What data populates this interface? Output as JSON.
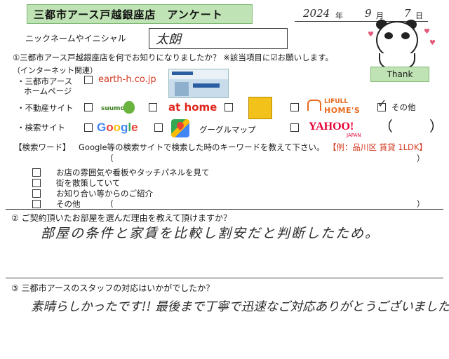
{
  "header": {
    "title": "三都市アース戸越銀座店　アンケート",
    "date": {
      "year_value": "2024",
      "year_label": "年",
      "month_value": "9",
      "month_label": "月",
      "day_value": "7",
      "day_label": "日"
    }
  },
  "nickname": {
    "label": "ニックネームやイニシャル",
    "value": "太朗"
  },
  "q1": {
    "question": "①三都市アース戸越銀座店を何でお知りになりましたか？ ※該当項目に☑お願いします。",
    "internet_heading": "（インターネット関連）",
    "homepage_label_1": "・三都市アース",
    "homepage_label_2": "ホームページ",
    "homepage_url": "earth-h.co.jp",
    "realestate_label": "・不動産サイト",
    "suumo": "suumo",
    "athome": "at home",
    "lifull": "LIFULL",
    "homes": "HOME'S",
    "other_label": "その他",
    "search_label": "・検索サイト",
    "google_letters": [
      "G",
      "o",
      "o",
      "g",
      "l",
      "e"
    ],
    "google_colors": [
      "#4285f4",
      "#ea4335",
      "#fbbc05",
      "#4285f4",
      "#34a853",
      "#ea4335"
    ],
    "googlemap_label": "グーグルマップ",
    "yahoo": "YAHOO!",
    "yahoo_sub": "JAPAN",
    "keyword_label": "【検索ワード】",
    "keyword_desc": "Google等の検索サイトで検索した時のキーワードを教えて下さい。",
    "keyword_example": "【例：品川区 賃貸 1LDK】",
    "open_paren": "（",
    "close_paren": "）",
    "offline_items": [
      "お店の雰囲気や看板やタッチパネルを見て",
      "街を散策していて",
      "お知り合い等からのご紹介",
      "その他"
    ],
    "thank": "Thank"
  },
  "q2": {
    "question": "② ご契約頂いたお部屋を選んだ理由を教えて頂けますか？",
    "answer": "部屋の条件と家賃を比較し割安だと判断したため。"
  },
  "q3": {
    "question": "③ 三都市アースのスタッフの対応はいかがでしたか？",
    "answer": "素晴らしかったです!! 最後まで丁寧で迅速なご対応ありがとうございました!!"
  }
}
